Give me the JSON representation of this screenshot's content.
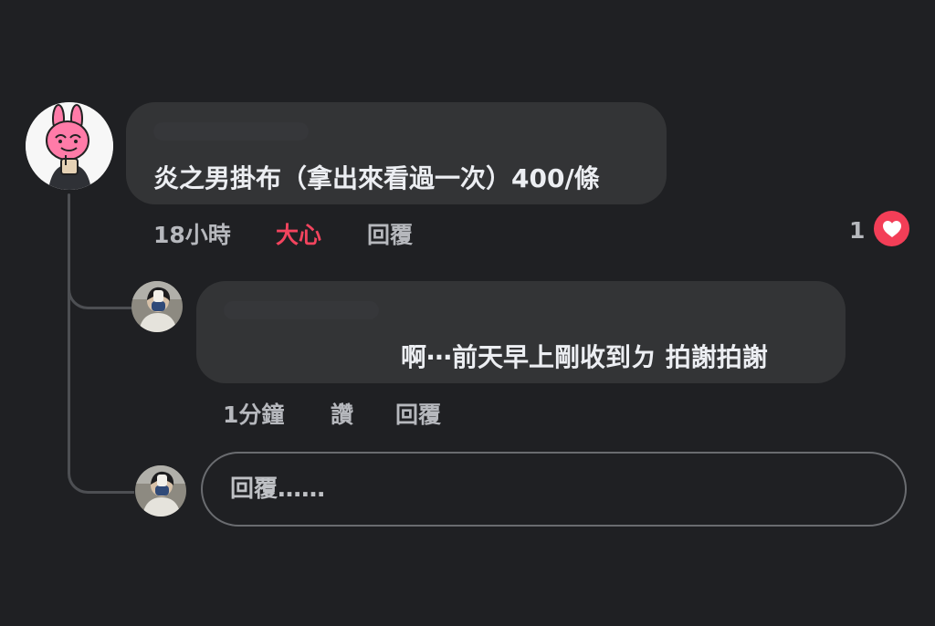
{
  "main_comment": {
    "avatar_icon": "pink-bunny-avatar-icon",
    "text": "炎之男掛布（拿出來看過一次）400/條",
    "time": "18小時",
    "reaction_label": "大心",
    "reply_label": "回覆",
    "reaction_count": "1",
    "reaction_icon": "heart-icon"
  },
  "reply_comment": {
    "avatar_icon": "masked-person-avatar-icon",
    "text": "啊⋯前天早上剛收到ㄉ 拍謝拍謝",
    "time": "1分鐘",
    "like_label": "讚",
    "reply_label": "回覆"
  },
  "composer": {
    "avatar_icon": "masked-person-avatar-icon",
    "placeholder": "回覆……"
  },
  "colors": {
    "background": "#1f2023",
    "bubble": "#333436",
    "accent": "#f3445e"
  }
}
